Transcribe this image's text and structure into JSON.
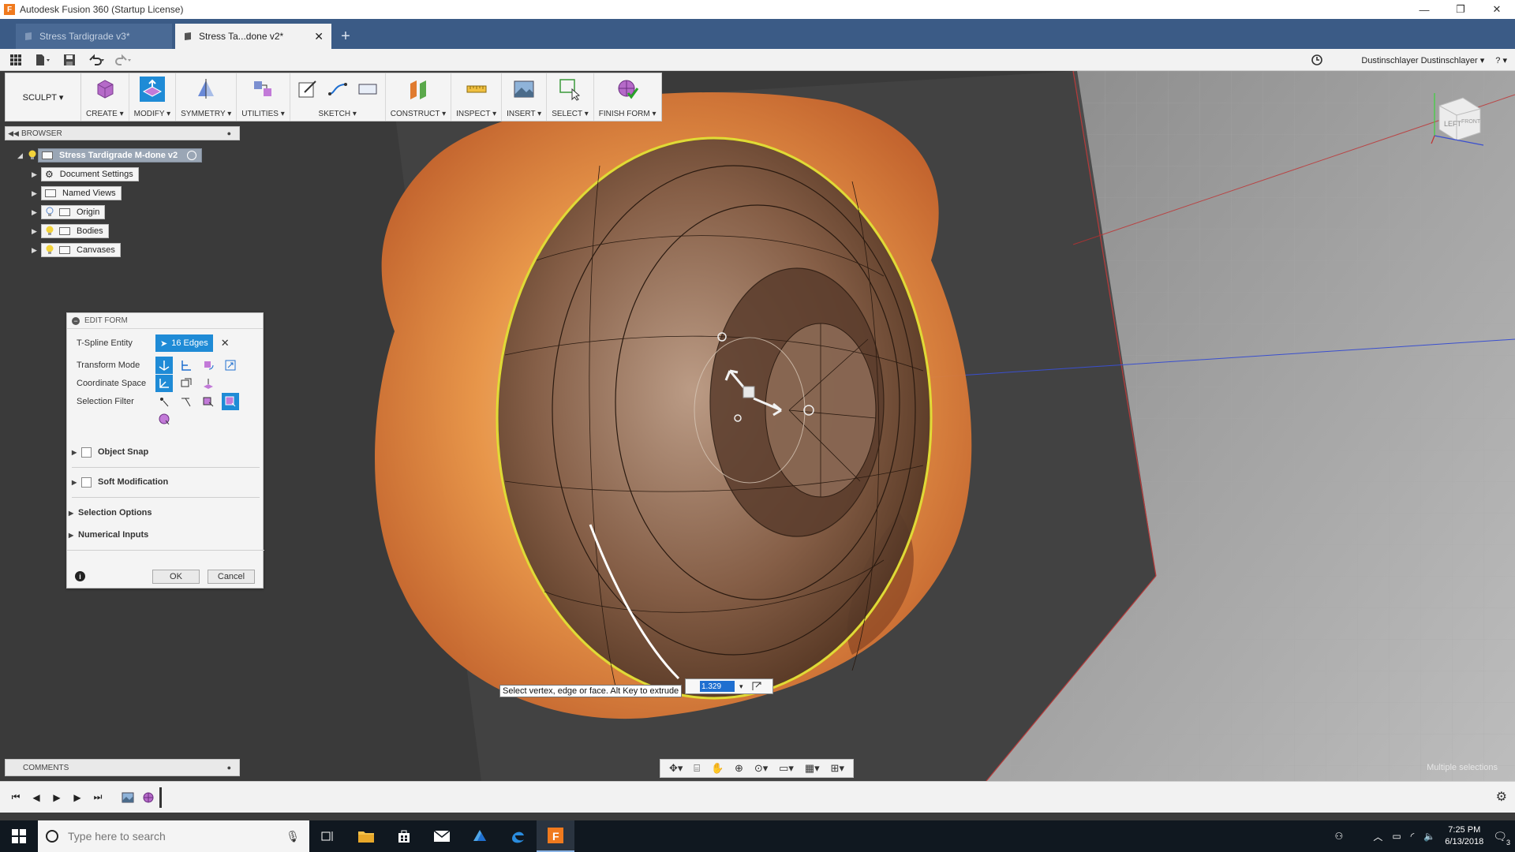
{
  "window": {
    "title": "Autodesk Fusion 360 (Startup License)",
    "minimize": "—",
    "maximize": "❐",
    "close": "✕"
  },
  "tabs": [
    {
      "label": "Stress Tardigrade v3*"
    },
    {
      "label": "Stress Ta...done v2*"
    }
  ],
  "new_tab": "+",
  "user": {
    "name": "Dustinschlayer Dustinschlayer ▾",
    "help": "? ▾"
  },
  "toolbar": {
    "workspace": "SCULPT ▾",
    "groups": [
      {
        "label": "CREATE ▾"
      },
      {
        "label": "MODIFY ▾"
      },
      {
        "label": "SYMMETRY ▾"
      },
      {
        "label": "UTILITIES ▾"
      },
      {
        "label": "SKETCH ▾"
      },
      {
        "label": "CONSTRUCT ▾"
      },
      {
        "label": "INSPECT ▾"
      },
      {
        "label": "INSERT ▾"
      },
      {
        "label": "SELECT ▾"
      },
      {
        "label": "FINISH FORM ▾"
      }
    ]
  },
  "browser": {
    "title": "BROWSER",
    "root": "Stress Tardigrade M-done v2",
    "items": [
      {
        "label": "Document Settings"
      },
      {
        "label": "Named Views"
      },
      {
        "label": "Origin"
      },
      {
        "label": "Bodies"
      },
      {
        "label": "Canvases"
      }
    ]
  },
  "edit_form": {
    "title": "EDIT FORM",
    "rows": {
      "entity": "T-Spline Entity",
      "transform": "Transform Mode",
      "coordinate": "Coordinate Space",
      "filter": "Selection Filter"
    },
    "entity_value": "16 Edges",
    "clear": "✕",
    "sections": {
      "object_snap": "Object Snap",
      "soft_mod": "Soft Modification",
      "selection_options": "Selection Options",
      "numerical_inputs": "Numerical Inputs"
    },
    "ok": "OK",
    "cancel": "Cancel",
    "info": "i"
  },
  "hint": "Select vertex, edge or face. Alt Key to extrude",
  "value_input": "1.329",
  "comments": {
    "title": "COMMENTS"
  },
  "status": {
    "multiple": "Multiple selections"
  },
  "viewcube": {
    "left": "LEFT",
    "front": "FRONT"
  },
  "taskbar": {
    "search_placeholder": "Type here to search",
    "time": "7:25 PM",
    "date": "6/13/2018",
    "notifications": "3"
  },
  "colors": {
    "accent": "#1f8bd6",
    "tabbar": "#3b5b86",
    "selection_yellow": "#e8e81a",
    "canvas_orange": "#e8853e"
  }
}
